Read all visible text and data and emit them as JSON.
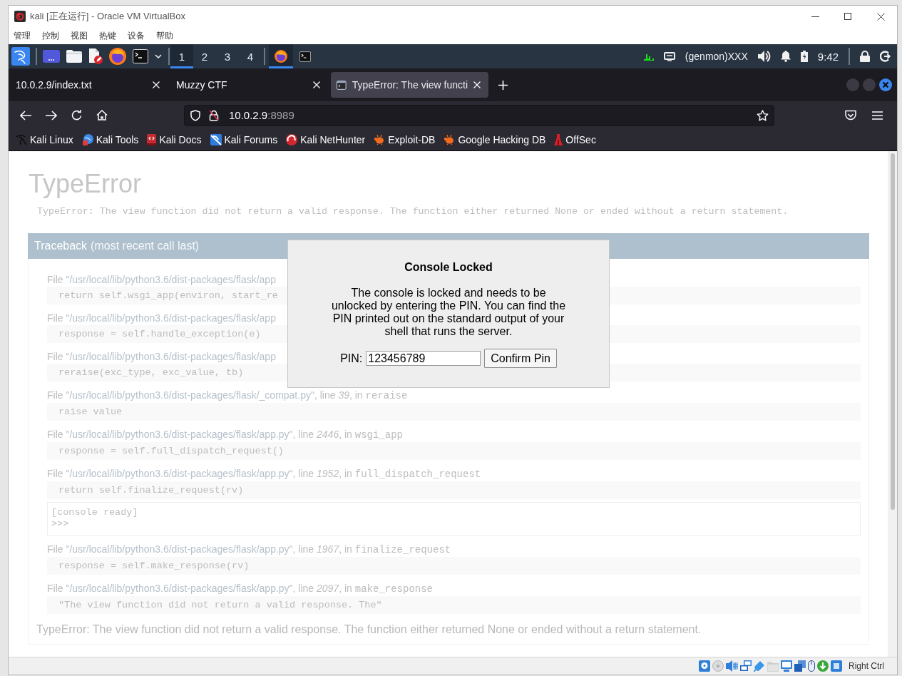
{
  "window": {
    "title": "kali [正在运行] - Oracle VM VirtualBox",
    "menu": [
      "管理",
      "控制",
      "视图",
      "热键",
      "设备",
      "帮助"
    ]
  },
  "panel": {
    "workspaces": [
      {
        "label": "1",
        "selected": true
      },
      {
        "label": "2",
        "selected": false
      },
      {
        "label": "3",
        "selected": false
      },
      {
        "label": "4",
        "selected": false
      }
    ],
    "tasks": [
      {
        "kind": "browser",
        "selected": true
      },
      {
        "kind": "terminal",
        "selected": false
      }
    ],
    "genmon": "(genmon)XXX",
    "clock": "9:42"
  },
  "browser": {
    "tabs": [
      {
        "title": "10.0.2.9/index.txt",
        "favicon": false,
        "selected": false
      },
      {
        "title": "Muzzy CTF",
        "favicon": false,
        "selected": false
      },
      {
        "title": "TypeError: The view functi",
        "favicon": true,
        "selected": true
      }
    ],
    "url": {
      "host": "10.0.2.9",
      "port": ":8989"
    },
    "bookmarks": [
      "Kali Linux",
      "Kali Tools",
      "Kali Docs",
      "Kali Forums",
      "Kali NetHunter",
      "Exploit-DB",
      "Google Hacking DB",
      "OffSec"
    ]
  },
  "page": {
    "title": "TypeError",
    "message": "TypeError: The view function did not return a valid response. The function either returned None or ended without a return statement.",
    "traceback": {
      "title": "Traceback",
      "note": "(most recent call last)",
      "frames": [
        {
          "file_label": "File",
          "path": "\"/usr/local/lib/python3.6/dist-packages/flask/app",
          "code": "return self.wsgi_app(environ, start_re"
        },
        {
          "file_label": "File",
          "path": "\"/usr/local/lib/python3.6/dist-packages/flask/app",
          "code": "response = self.handle_exception(e)"
        },
        {
          "file_label": "File",
          "path": "\"/usr/local/lib/python3.6/dist-packages/flask/app",
          "code": "reraise(exc_type, exc_value, tb)"
        },
        {
          "file_label": "File",
          "path": "\"/usr/local/lib/python3.6/dist-packages/flask/_compat.py\"",
          "line_label": ", line",
          "line": "39",
          "in_label": ", in",
          "function": "reraise",
          "code": "raise value"
        },
        {
          "file_label": "File",
          "path": "\"/usr/local/lib/python3.6/dist-packages/flask/app.py\"",
          "line_label": ", line",
          "line": "2446",
          "in_label": ", in",
          "function": "wsgi_app",
          "code": "response = self.full_dispatch_request()"
        },
        {
          "file_label": "File",
          "path": "\"/usr/local/lib/python3.6/dist-packages/flask/app.py\"",
          "line_label": ", line",
          "line": "1952",
          "in_label": ", in",
          "function": "full_dispatch_request",
          "code": "return self.finalize_request(rv)",
          "console": [
            "[console ready]",
            ">>>"
          ]
        },
        {
          "file_label": "File",
          "path": "\"/usr/local/lib/python3.6/dist-packages/flask/app.py\"",
          "line_label": ", line",
          "line": "1967",
          "in_label": ", in",
          "function": "finalize_request",
          "code": "response = self.make_response(rv)"
        },
        {
          "file_label": "File",
          "path": "\"/usr/local/lib/python3.6/dist-packages/flask/app.py\"",
          "line_label": ", line",
          "line": "2097",
          "in_label": ", in",
          "function": "make_response",
          "code": "\"The view function did not return a valid response. The\""
        }
      ]
    },
    "summary": "TypeError: The view function did not return a valid response. The function either returned None or ended without a return statement."
  },
  "dialog": {
    "title": "Console Locked",
    "text": "The console is locked and needs to be\nunlocked by entering the PIN. You can find the\nPIN printed out on the standard output of your\nshell that runs the server.",
    "pin_label": "PIN:",
    "pin_value": "123456789",
    "button": "Confirm Pin"
  },
  "status_bar": {
    "host_key": "Right Ctrl"
  }
}
